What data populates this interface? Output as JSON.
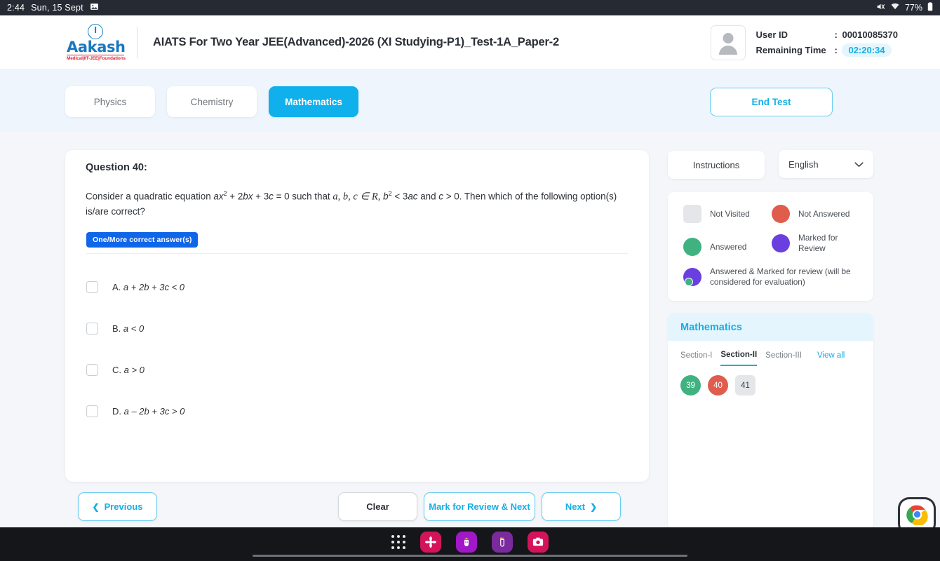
{
  "statusbar": {
    "time": "2:44",
    "date": "Sun, 15 Sept",
    "screenshot_icon": "image-icon",
    "mute_icon": "volume-mute-icon",
    "wifi_icon": "wifi-icon",
    "battery_text": "77%",
    "battery_icon": "battery-icon"
  },
  "header": {
    "logo_name": "Aakash",
    "logo_tagline": "Medical|IIT-JEE|Foundations",
    "test_title": "AIATS For Two Year JEE(Advanced)-2026 (XI Studying-P1)_Test-1A_Paper-2",
    "user_id_label": "User ID",
    "user_id_colon": ":",
    "user_id_value": "00010085370",
    "remaining_label": "Remaining Time",
    "remaining_colon": ":",
    "remaining_value": "02:20:34",
    "avatar_icon": "user-avatar-icon"
  },
  "subjectbar": {
    "tabs": [
      {
        "label": "Physics",
        "active": false
      },
      {
        "label": "Chemistry",
        "active": false
      },
      {
        "label": "Mathematics",
        "active": true
      }
    ],
    "end_test_label": "End Test"
  },
  "question": {
    "title": "Question 40:",
    "text_part1": "Consider a quadratic equation ",
    "var_ax": "ax",
    "sup_2a": "2",
    "text_part2": " + 2",
    "var_bx": "bx",
    "text_part3": " + 3",
    "var_c1": "c",
    "text_part4": " = 0 such that ",
    "set_vars": "a, b, c",
    "member_sign": "∈",
    "set_R": "R,",
    "var_b": "b",
    "sup_2b": "2",
    "text_part5": " < 3",
    "var_ac": "ac",
    "text_part6": " and ",
    "var_c2": "c",
    "text_part7": " > 0. Then which of the following option(s) is/are correct?",
    "answer_type_badge": "One/More correct answer(s)",
    "options": [
      {
        "letter": "A.",
        "text_html": "a + 2b + 3c < 0"
      },
      {
        "letter": "B.",
        "text_html": "a < 0"
      },
      {
        "letter": "C.",
        "text_html": "a > 0"
      },
      {
        "letter": "D.",
        "text_html": "a – 2b + 3c > 0"
      }
    ]
  },
  "footer": {
    "previous_label": "Previous",
    "previous_icon": "chevron-left-icon",
    "clear_label": "Clear",
    "mark_review_label": "Mark for Review & Next",
    "next_label": "Next",
    "next_icon": "chevron-right-icon"
  },
  "right_panel": {
    "instructions_label": "Instructions",
    "language_value": "English",
    "language_chevron_icon": "chevron-down-icon",
    "legend": [
      {
        "label": "Not Visited",
        "shape": "square",
        "color": "#e4e6e9"
      },
      {
        "label": "Not Answered",
        "shape": "circle",
        "color": "#e05c4d"
      },
      {
        "label": "Answered",
        "shape": "circle",
        "color": "#3fb27f"
      },
      {
        "label": "Marked for Review",
        "shape": "circle",
        "color": "#6a3fe0"
      },
      {
        "label": "Answered & Marked for review (will be considered for evaluation)",
        "shape": "circle-badge",
        "color": "#6a3fe0",
        "badge_color": "#3fb27f"
      }
    ],
    "section_title": "Mathematics",
    "section_tabs": [
      {
        "label": "Section-I",
        "active": false
      },
      {
        "label": "Section-II",
        "active": true
      },
      {
        "label": "Section-III",
        "active": false
      }
    ],
    "view_all_label": "View all",
    "question_numbers": [
      {
        "num": "39",
        "state": "answered"
      },
      {
        "num": "40",
        "state": "notanswered"
      },
      {
        "num": "41",
        "state": "notvisited"
      }
    ]
  },
  "taskbar": {
    "apps_grid_icon": "app-drawer-icon",
    "apps": [
      {
        "name": "flower-app-icon",
        "color": "#d4145a"
      },
      {
        "name": "purple-character-app-icon",
        "color": "#a018c8"
      },
      {
        "name": "crown-character-app-icon",
        "color": "#7b2a9d"
      },
      {
        "name": "camera-app-icon",
        "color": "#d4145a"
      }
    ],
    "chrome_icon": "chrome-icon"
  }
}
